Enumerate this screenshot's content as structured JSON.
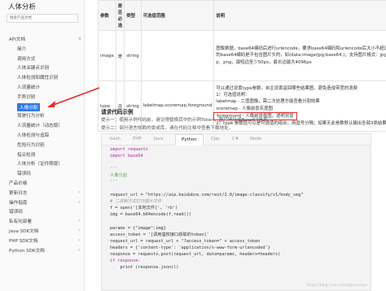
{
  "sidebar": {
    "title": "人体分析",
    "search_placeholder": "搜索产品文档",
    "items": [
      {
        "label": "API文档",
        "level": "top",
        "chev": "∨"
      },
      {
        "label": "简介",
        "level": "sub"
      },
      {
        "label": "调用方式",
        "level": "sub"
      },
      {
        "label": "人体关键点识别",
        "level": "sub"
      },
      {
        "label": "人体检测和属性识别",
        "level": "sub"
      },
      {
        "label": "人流量统计",
        "level": "sub"
      },
      {
        "label": "手势识别",
        "level": "sub"
      },
      {
        "label": "人像分割",
        "level": "active"
      },
      {
        "label": "驾驶行为分析",
        "level": "sub"
      },
      {
        "label": "人流量统计（动态版）",
        "level": "sub"
      },
      {
        "label": "人体检测与追踪",
        "level": "sub"
      },
      {
        "label": "危险行为识别",
        "level": "sub"
      },
      {
        "label": "指尖检测",
        "level": "sub"
      },
      {
        "label": "人体分析（证件照版）",
        "level": "sub"
      },
      {
        "label": "错误码",
        "level": "sub"
      },
      {
        "label": "产品价格",
        "level": "top"
      },
      {
        "label": "更新日志",
        "level": "top",
        "chev": "›"
      },
      {
        "label": "操作指南",
        "level": "top",
        "chev": "›"
      },
      {
        "label": "错误码",
        "level": "top"
      },
      {
        "label": "私有化部署",
        "level": "top",
        "chev": "›"
      },
      {
        "label": "Java SDK文档",
        "level": "top",
        "chev": "›"
      },
      {
        "label": "PHP SDK文档",
        "level": "top",
        "chev": "›"
      },
      {
        "label": "Python SDK文档",
        "level": "top",
        "chev": "›"
      }
    ]
  },
  "param_table": {
    "headers": [
      "参数",
      "是否必选",
      "类型",
      "可选值范围",
      "说明"
    ],
    "rows": [
      {
        "name": "image",
        "required": "是",
        "type": "string",
        "range": [],
        "desc": [
          "图像数据，base64编码后进行urlencode，要求base64编码和urlencode后大小不超过4M。图片",
          "的base64编码是不包含图片头的，如(data:image/jpg;base64,)，支持图片格式：jpg、bm",
          "p、png，最短边至少50px，最长边最大4096px"
        ]
      },
      {
        "name": "type",
        "required": "否",
        "type": "string",
        "range": [
          "labelmap,scoremap,foreground"
        ],
        "desc_before": [
          "可以通过设置type参数，自主设置返回哪些结果图，避免造成带宽的浪费",
          "1）可选值说明：",
          "labelmap - 二值图像，需二次处理方能查看分割效果",
          "scoremap - 人像前景灰度图"
        ],
        "desc_highlight": "foreground - 人像前景抠图，透明背景",
        "desc_after": [
          "2）type 参数值可以是可选值的组合，用逗号分隔；如果无此参数默认输出全部3类结果图"
        ]
      }
    ]
  },
  "section_title": "请求代码示例",
  "hints": [
    "提示一：使用示例代码前，请记得替换其中的示例Token、图片地址或Base64信息。",
    "提示二：部分语言依赖的类或库，请在代码注释中查看下载地址。"
  ],
  "code_tabs": [
    "bash",
    "PHP",
    "Java",
    "Python",
    "Cpp",
    "C#",
    "Node"
  ],
  "code_active_tab": "Python",
  "code_lines": [
    "import requests",
    "import base64",
    "",
    "'''",
    "人像分割",
    "'''",
    "",
    "request_url = \"https://aip.baidubce.com/rest/2.0/image-classify/v1/body_seg\"",
    "# 二进制方式打开图片文件",
    "f = open('[本地文件]', 'rb')",
    "img = base64.b64encode(f.read())",
    "",
    "params = {\"image\":img}",
    "access_token = '[调用鉴权接口获取的token]'",
    "request_url = request_url + \"?access_token=\" + access_token",
    "headers = {'content-type': 'application/x-www-form-urlencoded'}",
    "response = requests.post(request_url, data=params, headers=headers)",
    "if response:",
    "    print (response.json())"
  ],
  "watermark": "https://blog.csdn.net/qqianmoye",
  "colors": {
    "accent": "#2f7be5",
    "highlight_red": "#e52a2a"
  }
}
